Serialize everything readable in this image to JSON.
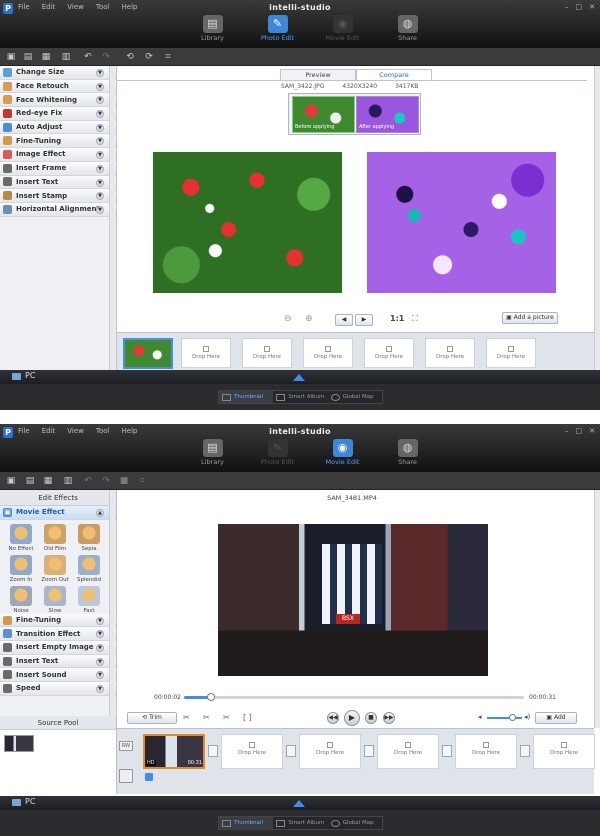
{
  "menu": [
    "File",
    "Edit",
    "View",
    "Tool",
    "Help"
  ],
  "logo": "intelli-studio",
  "window_controls": [
    "–",
    "□",
    "✕"
  ],
  "modes": [
    {
      "label": "Library",
      "icon": "library-icon"
    },
    {
      "label": "Photo Edit",
      "icon": "photo-edit-icon"
    },
    {
      "label": "Movie Edit",
      "icon": "movie-edit-icon"
    },
    {
      "label": "Share",
      "icon": "share-icon"
    }
  ],
  "photo_edit": {
    "sidebar_items": [
      {
        "label": "Change Size",
        "color": "#5aa0d8"
      },
      {
        "label": "Face Retouch",
        "color": "#d99a5a"
      },
      {
        "label": "Face Whitening",
        "color": "#d99a5a"
      },
      {
        "label": "Red-eye Fix",
        "color": "#c0392b"
      },
      {
        "label": "Auto Adjust",
        "color": "#4a8fd4"
      },
      {
        "label": "Fine-Tuning",
        "color": "#d39a4a"
      },
      {
        "label": "Image Effect",
        "color": "#d85a5a"
      },
      {
        "label": "Insert Frame",
        "color": "#6a6a6a"
      },
      {
        "label": "Insert Text",
        "color": "#6a6a6a"
      },
      {
        "label": "Insert Stamp",
        "color": "#b58a4a"
      },
      {
        "label": "Horizontal Alignment",
        "color": "#6a8fb5"
      }
    ],
    "tabs": [
      "Preview",
      "Compare"
    ],
    "file_info": {
      "name": "SAM_3422.JPG",
      "resolution": "4320X3240",
      "size": "3417KB"
    },
    "compare_thumbs": [
      "Before applying",
      "After applying"
    ],
    "zoom_label": "1:1",
    "add_picture": "Add a picture",
    "drop_label": "Drop Here",
    "drop_count": 7
  },
  "movie_edit": {
    "edit_effects_title": "Edit Effects",
    "movie_effect_title": "Movie Effect",
    "effects": [
      "No Effect",
      "Old Film",
      "Sepia",
      "Zoom In",
      "Zoom Out",
      "Splendid",
      "Noise",
      "Slow",
      "Fast"
    ],
    "sidebar_items": [
      {
        "label": "Fine-Tuning",
        "color": "#d39a4a"
      },
      {
        "label": "Transition Effect",
        "color": "#5a8fd4"
      },
      {
        "label": "Insert Empty Image",
        "color": "#6a6a6a"
      },
      {
        "label": "Insert Text",
        "color": "#6a6a6a"
      },
      {
        "label": "Insert Sound",
        "color": "#6a6a6a"
      },
      {
        "label": "Speed",
        "color": "#6a6a6a"
      }
    ],
    "source_pool_title": "Source Pool",
    "file_name": "SAM_3481.MP4",
    "time_start": "00:00:02",
    "time_end": "00:00:31",
    "trim_label": "Trim",
    "add_label": "Add",
    "drop_label": "Drop Here",
    "clip_hd_label": "HD",
    "clip_time": "00:31",
    "progress_fraction": 0.08
  },
  "status": {
    "pc_label": "PC"
  },
  "view_tabs": [
    "Thumbnail",
    "Smart Album",
    "Global Map"
  ]
}
